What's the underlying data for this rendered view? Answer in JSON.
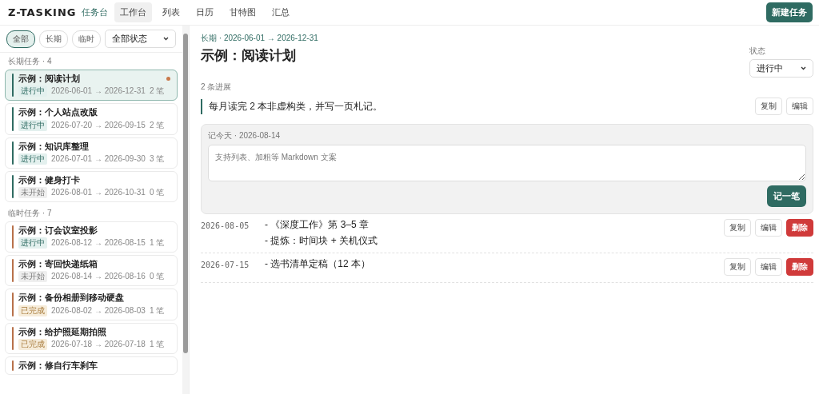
{
  "header": {
    "logo": "Z-TASKING",
    "subtitle": "任务台",
    "nav": [
      {
        "label": "工作台",
        "selected": true
      },
      {
        "label": "列表",
        "selected": false
      },
      {
        "label": "日历",
        "selected": false
      },
      {
        "label": "甘特图",
        "selected": false
      },
      {
        "label": "汇总",
        "selected": false
      }
    ],
    "new_button": "新建任务"
  },
  "sidebar": {
    "filters": [
      {
        "label": "全部",
        "selected": true
      },
      {
        "label": "长期",
        "selected": false
      },
      {
        "label": "临时",
        "selected": false
      }
    ],
    "status_select": "全部状态",
    "groups": [
      {
        "title": "长期任务 · 4",
        "color": "#2f6b62",
        "tasks": [
          {
            "title": "示例：阅读计划",
            "status": "进行中",
            "kind": "active",
            "dates": "2026-06-01 → 2026-12-31",
            "count": "2 笔",
            "selected": true,
            "dot": true
          },
          {
            "title": "示例：个人站点改版",
            "status": "进行中",
            "kind": "active",
            "dates": "2026-07-20 → 2026-09-15",
            "count": "2 笔",
            "selected": false,
            "dot": false
          },
          {
            "title": "示例：知识库整理",
            "status": "进行中",
            "kind": "active",
            "dates": "2026-07-01 → 2026-09-30",
            "count": "3 笔",
            "selected": false,
            "dot": false
          },
          {
            "title": "示例：健身打卡",
            "status": "未开始",
            "kind": "todo",
            "dates": "2026-08-01 → 2026-10-31",
            "count": "0 笔",
            "selected": false,
            "dot": false
          }
        ]
      },
      {
        "title": "临时任务 · 7",
        "color": "#b8714a",
        "tasks": [
          {
            "title": "示例：订会议室投影",
            "status": "进行中",
            "kind": "active",
            "dates": "2026-08-12 → 2026-08-15",
            "count": "1 笔",
            "selected": false,
            "dot": false
          },
          {
            "title": "示例：寄回快递纸箱",
            "status": "未开始",
            "kind": "todo",
            "dates": "2026-08-14 → 2026-08-16",
            "count": "0 笔",
            "selected": false,
            "dot": false
          },
          {
            "title": "示例：备份相册到移动硬盘",
            "status": "已完成",
            "kind": "done",
            "dates": "2026-08-02 → 2026-08-03",
            "count": "1 笔",
            "selected": false,
            "dot": false
          },
          {
            "title": "示例：给护照延期拍照",
            "status": "已完成",
            "kind": "done",
            "dates": "2026-07-18 → 2026-07-18",
            "count": "1 笔",
            "selected": false,
            "dot": false
          },
          {
            "title": "示例：修自行车刹车",
            "selected": false,
            "dot": false
          }
        ]
      }
    ]
  },
  "detail": {
    "breadcrumb": "长期 · 2026-06-01 → 2026-12-31",
    "title": "示例：阅读计划",
    "status_label": "状态",
    "status_value": "进行中",
    "progress_count": "2 条进展",
    "goal": "每月读完 2 本非虚构类，并写一页札记。",
    "goal_actions": [
      "复制",
      "编辑"
    ],
    "composer": {
      "label": "记今天 · 2026-08-14",
      "placeholder": "支持列表、加粗等 Markdown 文案",
      "submit": "记一笔"
    },
    "entries": [
      {
        "date": "2026-08-05",
        "lines": [
          "- 《深度工作》第 3–5 章",
          "- 提炼：时间块 + 关机仪式"
        ],
        "actions": [
          "复制",
          "编辑",
          "删除"
        ]
      },
      {
        "date": "2026-07-15",
        "lines": [
          "- 选书清单定稿（12 本）"
        ],
        "actions": [
          "复制",
          "编辑",
          "删除"
        ]
      }
    ]
  }
}
